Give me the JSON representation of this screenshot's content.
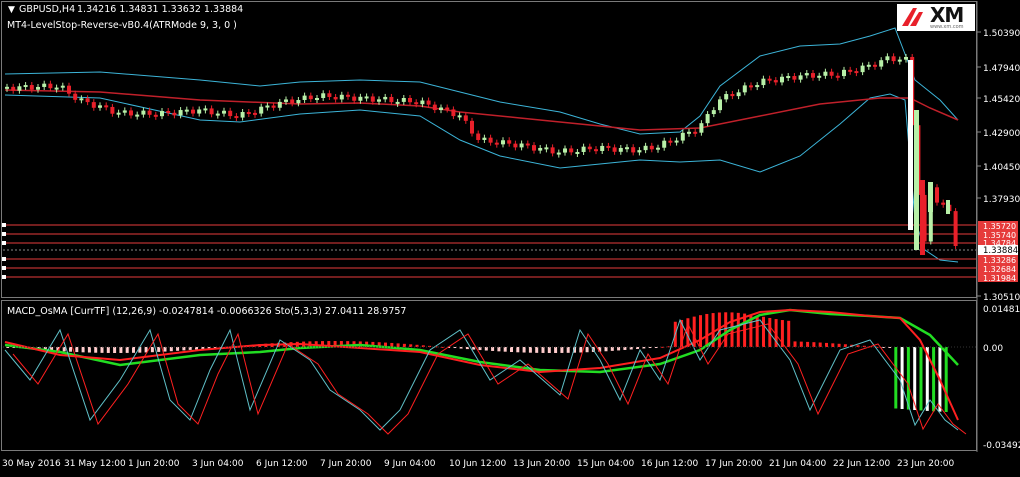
{
  "header": {
    "symbol_label": "GBPUSD,H4",
    "ohlc": "1.34216 1.34831 1.33632 1.33884",
    "indicator_label": "MT4-LevelStop-Reverse-vB0.4(ATRMode 9, 3, 0 )"
  },
  "logo": {
    "text": "XM",
    "subtext": "www.xm.com",
    "icon": "xm-wing-icon"
  },
  "price_axis": {
    "labels": [
      "1.50390",
      "1.47940",
      "1.45420",
      "1.42900",
      "1.40450",
      "1.37930",
      "1.35410",
      "1.32890",
      "1.30510"
    ],
    "current_price": "1.33884",
    "level_tags": [
      "1.35720",
      "1.35740",
      "1.34784",
      "1.33286",
      "1.32684",
      "1.31984"
    ]
  },
  "sub_window": {
    "label": "MACD_OsMA [CurrTF] (12,26,9) -0.0247814 -0.0066326  Sto(5,3,3) 27.0411 28.9757",
    "axis_labels": [
      "0.014814",
      "0.00",
      "-0.034929"
    ]
  },
  "time_axis": {
    "labels": [
      "30 May 2016",
      "31 May 12:00",
      "1 Jun 20:00",
      "3 Jun 04:00",
      "6 Jun 12:00",
      "7 Jun 20:00",
      "9 Jun 04:00",
      "10 Jun 12:00",
      "13 Jun 20:00",
      "15 Jun 04:00",
      "16 Jun 12:00",
      "17 Jun 20:00",
      "21 Jun 04:00",
      "22 Jun 12:00",
      "23 Jun 20:00"
    ]
  },
  "colors": {
    "background": "#000000",
    "bull_candle": "#b8f0a8",
    "bear_candle": "#e8202a",
    "bollinger": "#3cb4d8",
    "moving_average": "#c0202a",
    "levels": "#e63b3b",
    "macd_green": "#22dd22",
    "macd_red": "#ff2020",
    "stoch": "#5fc0c8"
  }
}
